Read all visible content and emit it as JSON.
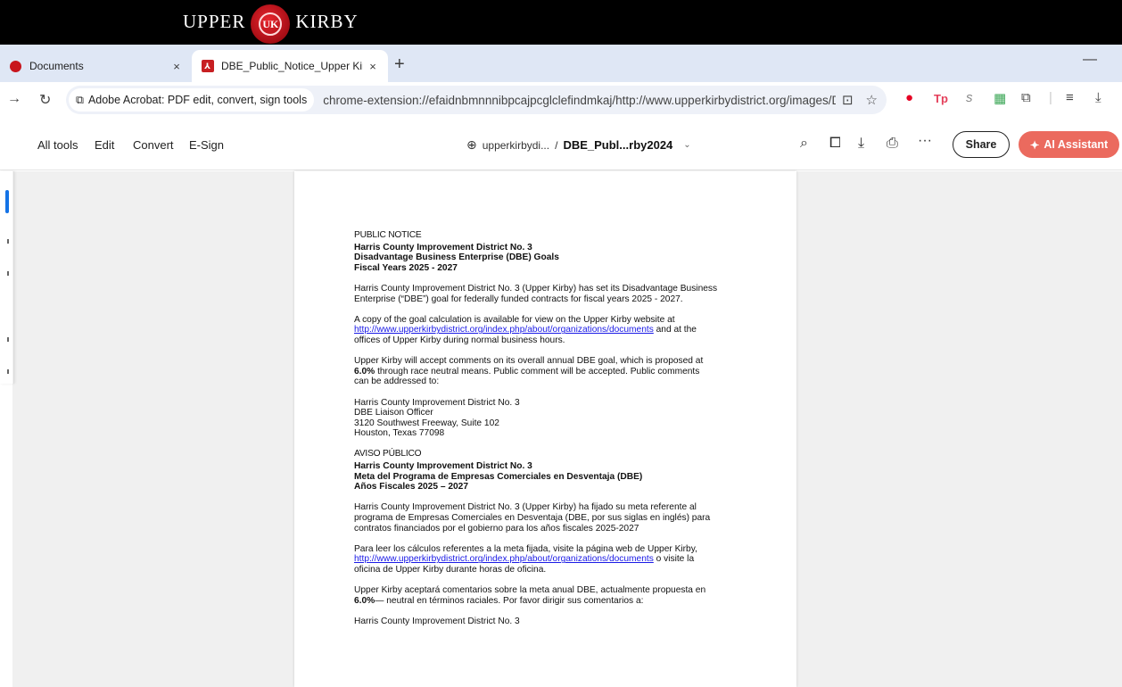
{
  "banner": {
    "word_left": "UPPER",
    "seal_text": "UK",
    "word_right": "KIRBY"
  },
  "tabs": [
    {
      "label": "Documents",
      "active": false
    },
    {
      "label": "DBE_Public_Notice_Upper Kirby",
      "active": true
    }
  ],
  "tab_close_glyph": "×",
  "new_tab_glyph": "+",
  "omnibox": {
    "site_chip": "Adobe Acrobat: PDF edit, convert, sign tools",
    "url": "chrome-extension://efaidnbmnnnibpcajpcglclefindmkaj/http://www.upperkirbydistrict.org/images/DB..."
  },
  "acrobat": {
    "menu": [
      "All tools",
      "Edit",
      "Convert",
      "E-Sign"
    ],
    "breadcrumb_site": "upperkirbydi...",
    "breadcrumb_sep": "/",
    "breadcrumb_file": "DBE_Publ...rby2024",
    "share_label": "Share",
    "ai_label": "AI Assistant"
  },
  "colors": {
    "ai_button": "#eb6a5e",
    "link": "#1a1ae6",
    "tab_strip": "#dfe7f5"
  },
  "document": {
    "en_label": "PUBLIC NOTICE",
    "en_title_1": "Harris County Improvement District No. 3",
    "en_title_2": "Disadvantage Business Enterprise (DBE) Goals",
    "en_title_3": "Fiscal Years 2025 - 2027",
    "en_p1_l1": "Harris County Improvement District No. 3 (Upper Kirby) has set its Disadvantage Business",
    "en_p1_l2": "Enterprise (“DBE”) goal for federally funded contracts for fiscal years 2025 - 2027.",
    "en_p2_l1": "A copy of the goal calculation is available for view on the Upper Kirby website at",
    "en_p2_link": "http://www.upperkirbydistrict.org/index.php/about/organizations/documents",
    "en_p2_l2_tail": " and at the",
    "en_p2_l3": "offices of Upper Kirby during normal business hours.",
    "en_p3_l1": "Upper Kirby will accept comments on its overall annual DBE goal, which is proposed at",
    "en_p3_bold": "6.0%",
    "en_p3_l2_tail": " through race neutral means. Public comment will be accepted. Public comments",
    "en_p3_l3": "can be addressed to:",
    "addr_1": "Harris County Improvement District No. 3",
    "addr_2": "DBE Liaison Officer",
    "addr_3": "3120 Southwest Freeway, Suite 102",
    "addr_4": "Houston, Texas 77098",
    "es_label": "AVISO PÚBLICO",
    "es_title_1": "Harris County Improvement District No. 3",
    "es_title_2": "Meta del Programa de Empresas Comerciales en Desventaja (DBE)",
    "es_title_3": "Años Fiscales 2025 – 2027",
    "es_p1_l1": "Harris County Improvement District No. 3 (Upper Kirby) ha fijado su meta referente al",
    "es_p1_l2": "programa de Empresas Comerciales en Desventaja (DBE, por sus siglas en inglés) para",
    "es_p1_l3": "contratos financiados por el gobierno para los años fiscales 2025-2027",
    "es_p2_l1": "Para leer los cálculos referentes a la meta fijada, visite la página web de Upper Kirby,",
    "es_p2_link": "http://www.upperkirbydistrict.org/index.php/about/organizations/documents",
    "es_p2_l2_tail": " o visite la",
    "es_p2_l3": "oficina de Upper Kirby durante horas de oficina.",
    "es_p3_l1": "Upper Kirby aceptará comentarios sobre la meta anual DBE, actualmente propuesta en",
    "es_p3_bold": "6.0%",
    "es_p3_l2_tail": "— neutral en términos raciales. Por favor dirigir sus comentarios a:",
    "es_addr_cut": "Harris County Improvement District No. 3"
  }
}
